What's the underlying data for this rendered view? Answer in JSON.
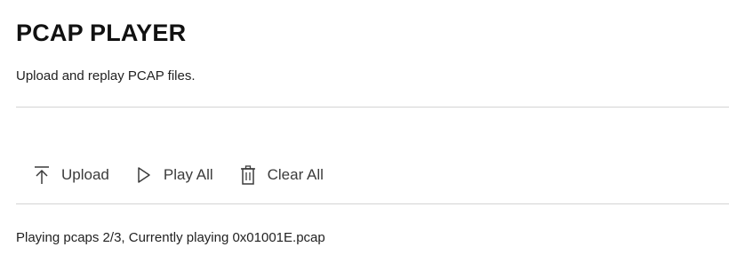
{
  "header": {
    "title": "PCAP PLAYER",
    "subtitle": "Upload and replay PCAP files."
  },
  "toolbar": {
    "upload": {
      "label": "Upload",
      "icon": "upload-icon"
    },
    "play_all": {
      "label": "Play All",
      "icon": "play-icon"
    },
    "clear_all": {
      "label": "Clear All",
      "icon": "trash-icon"
    }
  },
  "status": {
    "text": "Playing pcaps 2/3, Currently playing 0x01001E.pcap"
  },
  "colors": {
    "text": "#1a1a1a",
    "toolbar_text": "#3b3b3b",
    "divider": "#d4d4d4"
  }
}
